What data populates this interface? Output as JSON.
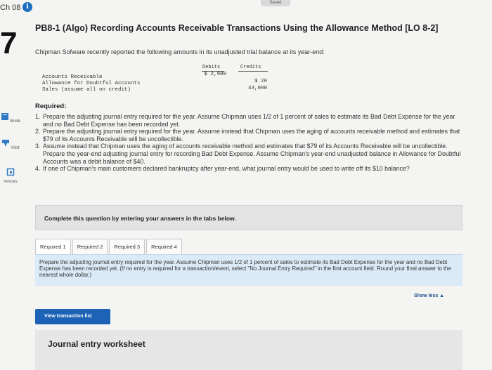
{
  "header": {
    "chapter": "Ch 08",
    "info_icon": "info-icon",
    "saved": "Saved"
  },
  "question_number": "7",
  "sidebar": [
    {
      "label": "Book",
      "icon": "book-icon",
      "color": "#2f7bc4"
    },
    {
      "label": "Hint",
      "icon": "hint-icon",
      "color": "#2f7bc4"
    },
    {
      "label": "rences",
      "icon": "references-icon",
      "color": "#2f7bc4"
    }
  ],
  "title": "PB8-1 (Algo) Recording Accounts Receivable Transactions Using the Allowance Method [LO 8-2]",
  "intro": "Chipman Sofware recently reported the following amounts in its unadjusted trial balance at its year-end:",
  "trial_balance": {
    "debits_header": "Debits",
    "credits_header": "Credits",
    "rows": [
      {
        "label": "Accounts Receivable",
        "debit": "$ 2,900",
        "credit": ""
      },
      {
        "label": "Allowance for Doubtful Accounts",
        "debit": "",
        "credit": "$ 20"
      },
      {
        "label": "Sales (assume all on credit)",
        "debit": "",
        "credit": "43,000"
      }
    ]
  },
  "required_heading": "Required:",
  "requirements": [
    {
      "num": "1.",
      "text": "Prepare the adjusting journal entry required for the year. Assume Chipman uses 1/2 of 1 percent of sales to estimate its Bad Debt Expense for the year and no Bad Debt Expense has been recorded yet."
    },
    {
      "num": "2.",
      "text": "Prepare the adjusting journal entry required for the year. Assume instead that Chipman uses the aging of accounts receivable method and estimates that $79 of its Accounts Receivable will be uncollectible."
    },
    {
      "num": "3.",
      "text": "Assume instead that Chipman uses the aging of accounts receivable method and estimates that $79 of its Accounts Receivable will be uncollectible. Prepare the year-end adjusting journal entry for recording Bad Debt Expense. Assume Chipman's year-end unadjusted balance in Allowance for Doubtful Accounts was a debit balance of $40."
    },
    {
      "num": "4.",
      "text": "If one of Chipman's main customers declared bankruptcy after year-end, what journal entry would be used to write off its $10 balance?"
    }
  ],
  "instruction_box": "Complete this question by entering your answers in the tabs below.",
  "tabs": [
    "Required 1",
    "Required 2",
    "Required 3",
    "Required 4"
  ],
  "active_tab": "Required 1",
  "panel_text": "Prepare the adjusting journal entry required for the year. Assume Chipman uses 1/2 of 1 percent of sales to estimate its Bad Debt Expense for the year and no Bad Debt Expense has been recorded yet. (If no entry is required for a transaction/event, select \"No Journal Entry Required\" in the first account field. Round your final answer to the nearest whole dollar.)",
  "show_less": "Show less ▲",
  "view_transaction_button": "View transaction list",
  "journal_worksheet": "Journal entry worksheet",
  "colors": {
    "accent": "#1c63b7",
    "panel": "#daeaf6"
  }
}
